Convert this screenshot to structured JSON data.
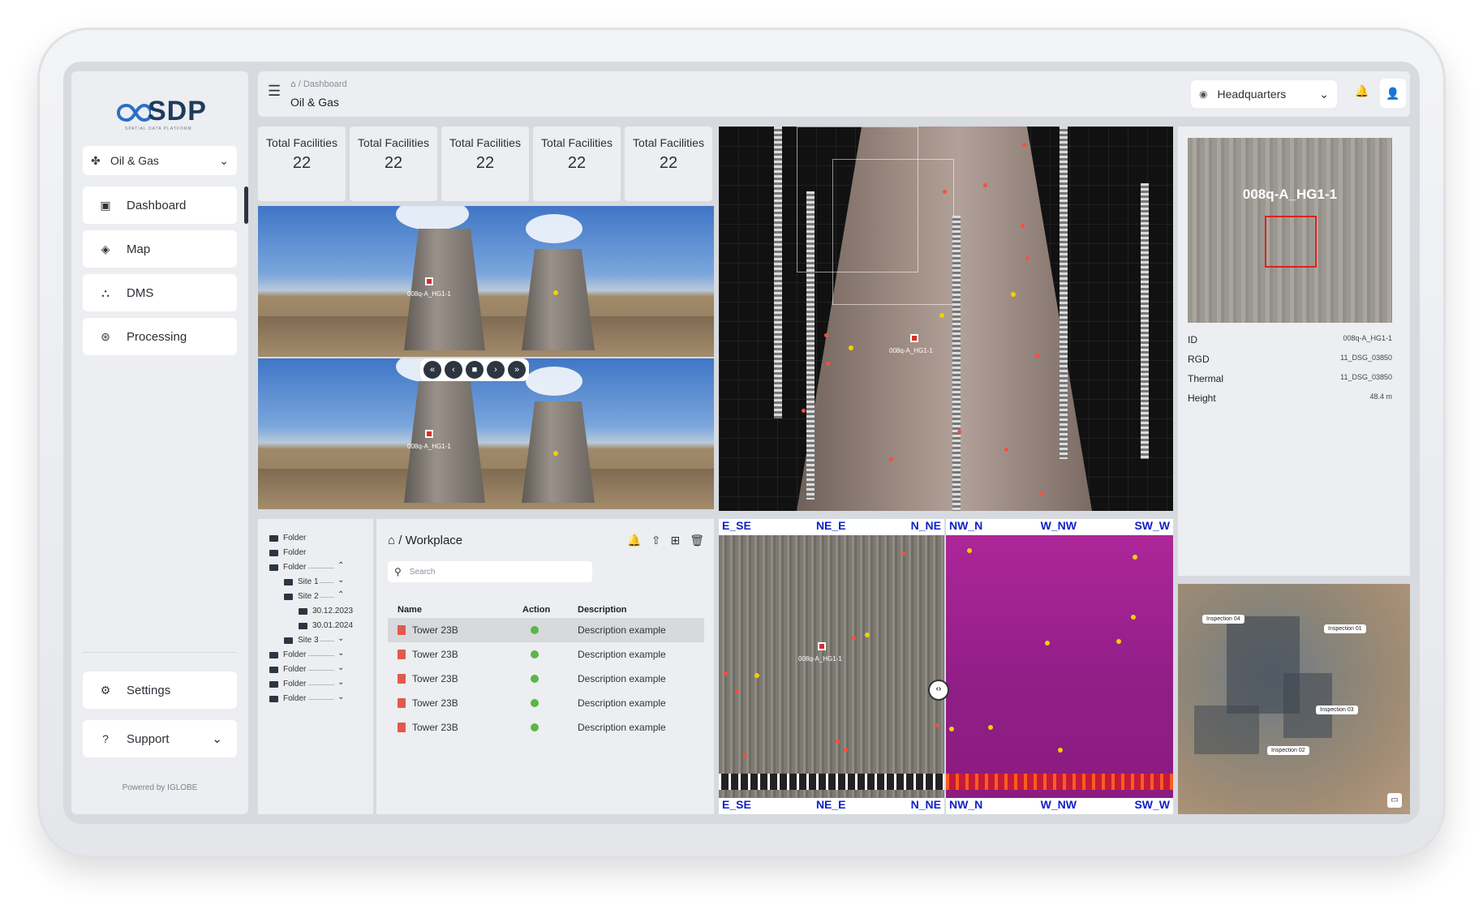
{
  "brand": {
    "logo_text": "SDP",
    "logo_sub": "SPATIAL DATA PLATFORM",
    "powered": "Powered by IGLOBE"
  },
  "sidebar": {
    "domain_selector": "Oil & Gas",
    "items": [
      {
        "label": "Dashboard",
        "icon": "dashboard-icon"
      },
      {
        "label": "Map",
        "icon": "map-icon"
      },
      {
        "label": "DMS",
        "icon": "dms-icon"
      },
      {
        "label": "Processing",
        "icon": "processing-icon"
      }
    ],
    "settings": "Settings",
    "support": "Support"
  },
  "header": {
    "breadcrumb": "/ Dashboard",
    "title": "Oil & Gas",
    "location": "Headquarters"
  },
  "stats": [
    {
      "label": "Total Facilities",
      "value": "22"
    },
    {
      "label": "Total Facilities",
      "value": "22"
    },
    {
      "label": "Total Facilities",
      "value": "22"
    },
    {
      "label": "Total Facilities",
      "value": "22"
    },
    {
      "label": "Total Facilities",
      "value": "22"
    }
  ],
  "marker_label": "008q-A_HG1-1",
  "details": {
    "title": "008q-A_HG1-1",
    "rows": [
      {
        "key": "ID",
        "value": "008q-A_HG1-1"
      },
      {
        "key": "RGD",
        "value": "11_DSG_03850"
      },
      {
        "key": "Thermal",
        "value": "11_DSG_03850"
      },
      {
        "key": "Height",
        "value": "48.4 m"
      }
    ]
  },
  "map_tags": [
    "Inspection 04",
    "Inspection 01",
    "Inspection 03",
    "Inspection 02"
  ],
  "tree": {
    "rows": [
      "Folder",
      "Folder",
      "Folder",
      "Site 1",
      "Site 2",
      "30.12.2023",
      "30.01.2024",
      "Site 3",
      "Folder",
      "Folder",
      "Folder",
      "Folder"
    ]
  },
  "workplace": {
    "title": "/ Workplace",
    "search_placeholder": "Search",
    "columns": [
      "Name",
      "Action",
      "Description"
    ],
    "rows": [
      {
        "name": "Tower 23B",
        "description": "Description example"
      },
      {
        "name": "Tower 23B",
        "description": "Description example"
      },
      {
        "name": "Tower 23B",
        "description": "Description example"
      },
      {
        "name": "Tower 23B",
        "description": "Description example"
      },
      {
        "name": "Tower 23B",
        "description": "Description example"
      }
    ]
  },
  "strips": {
    "rgb_labels": [
      "E_SE",
      "NE_E",
      "N_NE"
    ],
    "thermal_labels": [
      "NW_N",
      "W_NW",
      "SW_W"
    ]
  },
  "colors": {
    "accent": "#2d3640",
    "status_ok": "#5bb547",
    "marker": "#d32f2f",
    "strip_label": "#1020c8"
  }
}
